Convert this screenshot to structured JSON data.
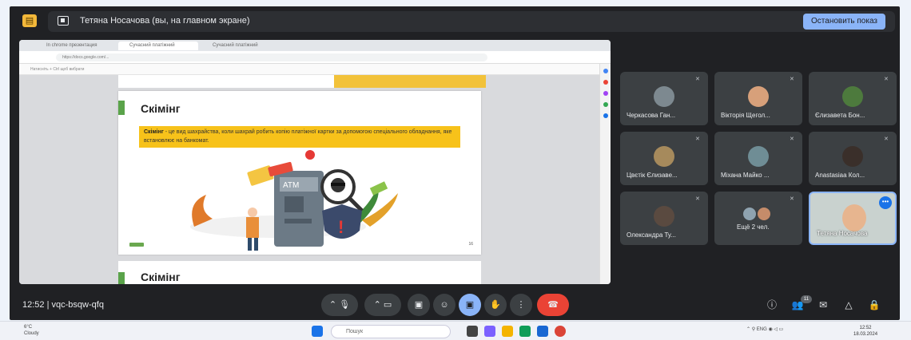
{
  "presenting": {
    "icon": "presentation-icon",
    "share_text": "Тетяна Носачова (вы, на главном экране)",
    "stop_label": "Остановить показ"
  },
  "browser": {
    "tabs": [
      "In chrome презентация",
      "Сучасний платіжний",
      "Сучасний платіжний"
    ],
    "address": "https://docs.google.com/...",
    "toolbar": "Натисніть + Ctrl щоб вибрати"
  },
  "slide": {
    "title": "Скімінг",
    "term": "Скімінг",
    "definition": " - це вид шахрайства, коли шахрай робить копію платіжної картки за допомогою спеціального обладнання, яке встановлює на банкомат.",
    "atm_label": "ATM",
    "page_num": "16",
    "next_title": "Скімінг"
  },
  "participants": [
    {
      "name": "Черкасова Ган..."
    },
    {
      "name": "Вікторія Щегол..."
    },
    {
      "name": "Єлизавета Бон..."
    },
    {
      "name": "Цвєтік Єлизаве..."
    },
    {
      "name": "Міхана Майко ..."
    },
    {
      "name": "Anastasiaa Кол..."
    },
    {
      "name": "Олександра Ту..."
    },
    {
      "name": "Ещё 2 чел."
    },
    {
      "name": "Тетяна Носачова"
    }
  ],
  "meeting": {
    "time": "12:52",
    "code": "vqc-bsqw-qfq",
    "people_badge": "11"
  },
  "taskbar": {
    "temp": "6°C",
    "weather": "Cloudy",
    "search_placeholder": "Пошук",
    "lang": "ENG",
    "time": "12:52",
    "date": "18.03.2024"
  }
}
